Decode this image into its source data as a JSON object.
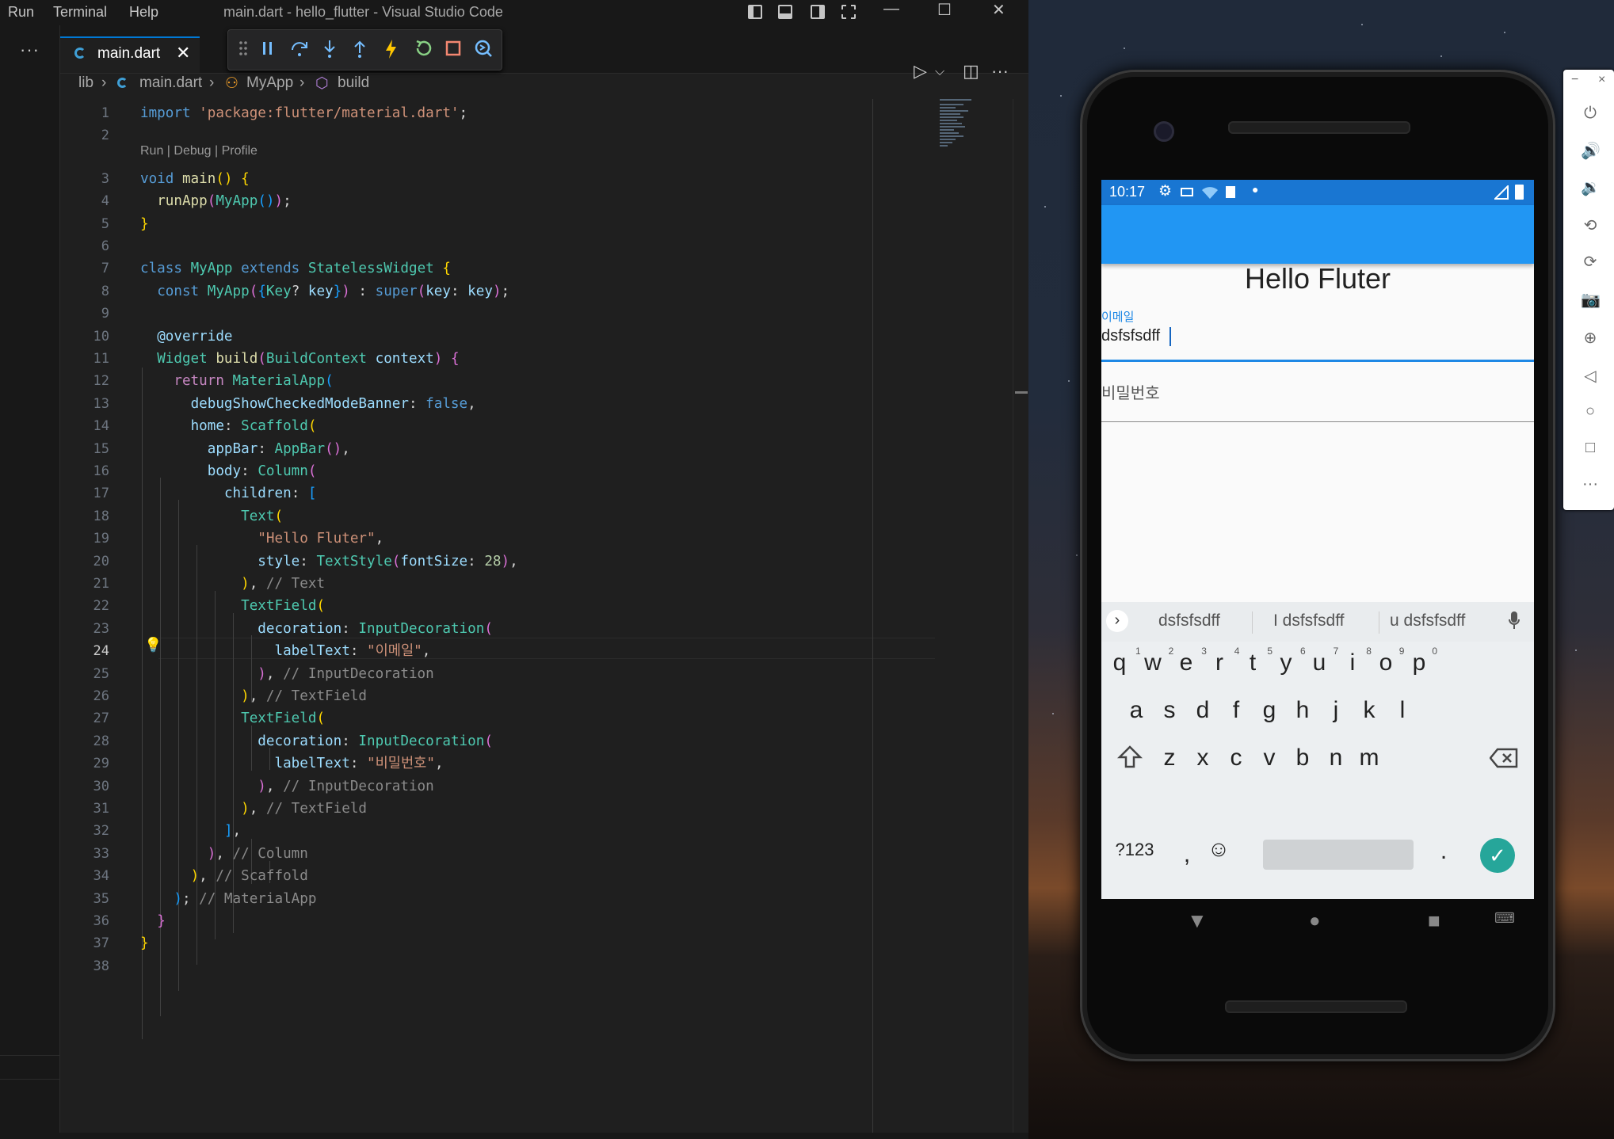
{
  "vscode": {
    "menu": [
      "Run",
      "Terminal",
      "Help"
    ],
    "window_title": "main.dart - hello_flutter - Visual Studio Code",
    "window_controls": {
      "minimize": "—",
      "maximize": "☐",
      "close": "✕"
    },
    "activity_more": "···",
    "tab": {
      "name": "main.dart",
      "close": "✕"
    },
    "debug_toolbar": [
      "drag-handle",
      "pause",
      "step-over",
      "step-into",
      "step-out",
      "hot-reload",
      "restart",
      "stop",
      "devtools"
    ],
    "editor_actions": {
      "run": "▷",
      "run_menu": "⌵",
      "split": "◫",
      "more": "···"
    },
    "breadcrumb": [
      "lib",
      "main.dart",
      "MyApp",
      "build"
    ],
    "codelens": "Run | Debug | Profile",
    "active_line": "24",
    "lines": [
      {
        "n": "1",
        "code": [
          [
            "k",
            "import "
          ],
          [
            "s",
            "'package:flutter/material.dart'"
          ],
          [
            "d",
            ";"
          ]
        ]
      },
      {
        "n": "2",
        "code": []
      },
      {
        "n": "3",
        "code": [
          [
            "k",
            "void "
          ],
          [
            "f",
            "main"
          ],
          [
            "b1",
            "()"
          ],
          [
            "d",
            " "
          ],
          [
            "b1",
            "{"
          ]
        ]
      },
      {
        "n": "4",
        "code": [
          [
            "d",
            "  "
          ],
          [
            "f",
            "runApp"
          ],
          [
            "b2",
            "("
          ],
          [
            "t",
            "MyApp"
          ],
          [
            "b3",
            "()"
          ],
          [
            "b2",
            ")"
          ],
          [
            "d",
            ";"
          ]
        ]
      },
      {
        "n": "5",
        "code": [
          [
            "b1",
            "}"
          ]
        ]
      },
      {
        "n": "6",
        "code": []
      },
      {
        "n": "7",
        "code": [
          [
            "k",
            "class "
          ],
          [
            "t",
            "MyApp "
          ],
          [
            "k",
            "extends "
          ],
          [
            "t",
            "StatelessWidget "
          ],
          [
            "b1",
            "{"
          ]
        ]
      },
      {
        "n": "8",
        "code": [
          [
            "d",
            "  "
          ],
          [
            "k",
            "const "
          ],
          [
            "t",
            "MyApp"
          ],
          [
            "b2",
            "("
          ],
          [
            "b3",
            "{"
          ],
          [
            "t",
            "Key"
          ],
          [
            "d",
            "? "
          ],
          [
            "v",
            "key"
          ],
          [
            "b3",
            "}"
          ],
          [
            "b2",
            ")"
          ],
          [
            "d",
            " : "
          ],
          [
            "k",
            "super"
          ],
          [
            "b2",
            "("
          ],
          [
            "v",
            "key"
          ],
          [
            "d",
            ": "
          ],
          [
            "v",
            "key"
          ],
          [
            "b2",
            ")"
          ],
          [
            "d",
            ";"
          ]
        ]
      },
      {
        "n": "9",
        "code": []
      },
      {
        "n": "10",
        "code": [
          [
            "d",
            "  "
          ],
          [
            "v",
            "@override"
          ]
        ]
      },
      {
        "n": "11",
        "code": [
          [
            "d",
            "  "
          ],
          [
            "t",
            "Widget "
          ],
          [
            "f",
            "build"
          ],
          [
            "b2",
            "("
          ],
          [
            "t",
            "BuildContext "
          ],
          [
            "v",
            "context"
          ],
          [
            "b2",
            ")"
          ],
          [
            "d",
            " "
          ],
          [
            "b2",
            "{"
          ]
        ]
      },
      {
        "n": "12",
        "code": [
          [
            "d",
            "    "
          ],
          [
            "kc",
            "return "
          ],
          [
            "t",
            "MaterialApp"
          ],
          [
            "b3",
            "("
          ]
        ]
      },
      {
        "n": "13",
        "code": [
          [
            "d",
            "      "
          ],
          [
            "v",
            "debugShowCheckedModeBanner"
          ],
          [
            "d",
            ": "
          ],
          [
            "k",
            "false"
          ],
          [
            "d",
            ","
          ]
        ]
      },
      {
        "n": "14",
        "code": [
          [
            "d",
            "      "
          ],
          [
            "v",
            "home"
          ],
          [
            "d",
            ": "
          ],
          [
            "t",
            "Scaffold"
          ],
          [
            "b1",
            "("
          ]
        ]
      },
      {
        "n": "15",
        "code": [
          [
            "d",
            "        "
          ],
          [
            "v",
            "appBar"
          ],
          [
            "d",
            ": "
          ],
          [
            "t",
            "AppBar"
          ],
          [
            "b2",
            "()"
          ],
          [
            "d",
            ","
          ]
        ]
      },
      {
        "n": "16",
        "code": [
          [
            "d",
            "        "
          ],
          [
            "v",
            "body"
          ],
          [
            "d",
            ": "
          ],
          [
            "t",
            "Column"
          ],
          [
            "b2",
            "("
          ]
        ]
      },
      {
        "n": "17",
        "code": [
          [
            "d",
            "          "
          ],
          [
            "v",
            "children"
          ],
          [
            "d",
            ": "
          ],
          [
            "b3",
            "["
          ]
        ]
      },
      {
        "n": "18",
        "code": [
          [
            "d",
            "            "
          ],
          [
            "t",
            "Text"
          ],
          [
            "b1",
            "("
          ]
        ]
      },
      {
        "n": "19",
        "code": [
          [
            "d",
            "              "
          ],
          [
            "s",
            "\"Hello Fluter\""
          ],
          [
            "d",
            ","
          ]
        ]
      },
      {
        "n": "20",
        "code": [
          [
            "d",
            "              "
          ],
          [
            "v",
            "style"
          ],
          [
            "d",
            ": "
          ],
          [
            "t",
            "TextStyle"
          ],
          [
            "b2",
            "("
          ],
          [
            "v",
            "fontSize"
          ],
          [
            "d",
            ": "
          ],
          [
            "n",
            "28"
          ],
          [
            "b2",
            ")"
          ],
          [
            "d",
            ","
          ]
        ]
      },
      {
        "n": "21",
        "code": [
          [
            "d",
            "            "
          ],
          [
            "b1",
            ")"
          ],
          [
            "d",
            ", "
          ],
          [
            "c8",
            "// Text"
          ]
        ]
      },
      {
        "n": "22",
        "code": [
          [
            "d",
            "            "
          ],
          [
            "t",
            "TextField"
          ],
          [
            "b1",
            "("
          ]
        ]
      },
      {
        "n": "23",
        "code": [
          [
            "d",
            "              "
          ],
          [
            "v",
            "decoration"
          ],
          [
            "d",
            ": "
          ],
          [
            "t",
            "InputDecoration"
          ],
          [
            "b2",
            "("
          ]
        ]
      },
      {
        "n": "24",
        "code": [
          [
            "d",
            "                "
          ],
          [
            "v",
            "labelText"
          ],
          [
            "d",
            ": "
          ],
          [
            "s",
            "\"이메일\""
          ],
          [
            "d",
            ","
          ]
        ]
      },
      {
        "n": "25",
        "code": [
          [
            "d",
            "              "
          ],
          [
            "b2",
            ")"
          ],
          [
            "d",
            ", "
          ],
          [
            "c8",
            "// InputDecoration"
          ]
        ]
      },
      {
        "n": "26",
        "code": [
          [
            "d",
            "            "
          ],
          [
            "b1",
            ")"
          ],
          [
            "d",
            ", "
          ],
          [
            "c8",
            "// TextField"
          ]
        ]
      },
      {
        "n": "27",
        "code": [
          [
            "d",
            "            "
          ],
          [
            "t",
            "TextField"
          ],
          [
            "b1",
            "("
          ]
        ]
      },
      {
        "n": "28",
        "code": [
          [
            "d",
            "              "
          ],
          [
            "v",
            "decoration"
          ],
          [
            "d",
            ": "
          ],
          [
            "t",
            "InputDecoration"
          ],
          [
            "b2",
            "("
          ]
        ]
      },
      {
        "n": "29",
        "code": [
          [
            "d",
            "                "
          ],
          [
            "v",
            "labelText"
          ],
          [
            "d",
            ": "
          ],
          [
            "s",
            "\"비밀번호\""
          ],
          [
            "d",
            ","
          ]
        ]
      },
      {
        "n": "30",
        "code": [
          [
            "d",
            "              "
          ],
          [
            "b2",
            ")"
          ],
          [
            "d",
            ", "
          ],
          [
            "c8",
            "// InputDecoration"
          ]
        ]
      },
      {
        "n": "31",
        "code": [
          [
            "d",
            "            "
          ],
          [
            "b1",
            ")"
          ],
          [
            "d",
            ", "
          ],
          [
            "c8",
            "// TextField"
          ]
        ]
      },
      {
        "n": "32",
        "code": [
          [
            "d",
            "          "
          ],
          [
            "b3",
            "]"
          ],
          [
            "d",
            ","
          ]
        ]
      },
      {
        "n": "33",
        "code": [
          [
            "d",
            "        "
          ],
          [
            "b2",
            ")"
          ],
          [
            "d",
            ", "
          ],
          [
            "c8",
            "// Column"
          ]
        ]
      },
      {
        "n": "34",
        "code": [
          [
            "d",
            "      "
          ],
          [
            "b1",
            ")"
          ],
          [
            "d",
            ", "
          ],
          [
            "c8",
            "// Scaffold"
          ]
        ]
      },
      {
        "n": "35",
        "code": [
          [
            "d",
            "    "
          ],
          [
            "b3",
            ")"
          ],
          [
            "d",
            "; "
          ],
          [
            "c8",
            "// MaterialApp"
          ]
        ]
      },
      {
        "n": "36",
        "code": [
          [
            "d",
            "  "
          ],
          [
            "b2",
            "}"
          ]
        ]
      },
      {
        "n": "37",
        "code": [
          [
            "b1",
            "}"
          ]
        ]
      },
      {
        "n": "38",
        "code": []
      }
    ]
  },
  "phone": {
    "status_time": "10:17",
    "app_text": "Hello Fluter",
    "email_label": "이메일",
    "email_value": "dsfsfsdff",
    "password_label": "비밀번호",
    "suggestions": [
      "dsfsfsdff",
      "I dsfsfsdff",
      "u dsfsfsdff"
    ],
    "keyboard": {
      "row1": [
        "q",
        "w",
        "e",
        "r",
        "t",
        "y",
        "u",
        "i",
        "o",
        "p"
      ],
      "row1_hints": [
        "1",
        "2",
        "3",
        "4",
        "5",
        "6",
        "7",
        "8",
        "9",
        "0"
      ],
      "row2": [
        "a",
        "s",
        "d",
        "f",
        "g",
        "h",
        "j",
        "k",
        "l"
      ],
      "row3": [
        "z",
        "x",
        "c",
        "v",
        "b",
        "n",
        "m"
      ],
      "sym": "?123",
      "comma": ",",
      "period": ".",
      "enter": "✓"
    },
    "nav": {
      "back": "▼",
      "home": "●",
      "recents": "■",
      "keyboard": "⌨"
    }
  },
  "emulator_toolbar": {
    "close": "×",
    "minimize": "−",
    "buttons": [
      "power-icon",
      "volume-up-icon",
      "volume-down-icon",
      "rotate-left-icon",
      "rotate-right-icon",
      "camera-icon",
      "zoom-icon",
      "back-icon",
      "home-icon",
      "overview-icon",
      "more-icon"
    ]
  }
}
